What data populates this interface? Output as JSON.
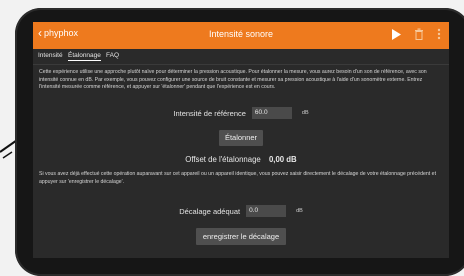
{
  "app": {
    "back_label": "phyphox",
    "title": "Intensité sonore"
  },
  "tabs": [
    {
      "label": "Intensité"
    },
    {
      "label": "Étalonnage"
    },
    {
      "label": "FAQ"
    }
  ],
  "content": {
    "intro_text": "Cette expérience utilise une approche plutôt naïve pour déterminer la pression acoustique. Pour étalonner la mesure, vous aurez besoin d'un son de référence, avec son intensité connue en dB. Par exemple, vous pouvez configurer une source de bruit constante et mesurer sa pression acoustique à l'aide d'un sonomètre externe. Entrez l'intensité mesurée comme référence, et appuyer sur 'étalonner' pendant que l'expérience est en cours.",
    "reference_label": "Intensité de référence",
    "reference_value": "60.0",
    "reference_unit": "dB",
    "calibrate_button": "Étalonner",
    "offset_label": "Offset de l'étalonnage",
    "offset_value": "0,00 dB",
    "previous_text": "Si vous avez déjà effectué cette opération auparavant sur cet appareil ou un appareil identique, vous pouvez saisir directement le décalage de votre étalonnage précédent et appuyer sur 'enregistrer le décalage'.",
    "offset_input_label": "Décalage adéquat",
    "offset_input_value": "0.0",
    "offset_input_unit": "dB",
    "save_button": "enregistrer le décalage"
  },
  "colors": {
    "accent": "#ee7a1e",
    "background": "#2a2a2a",
    "input": "#4a4a4a",
    "button": "#4f4f4f"
  },
  "icons": [
    "back-chevron-icon",
    "play-icon",
    "trash-icon",
    "more-vertical-icon"
  ]
}
